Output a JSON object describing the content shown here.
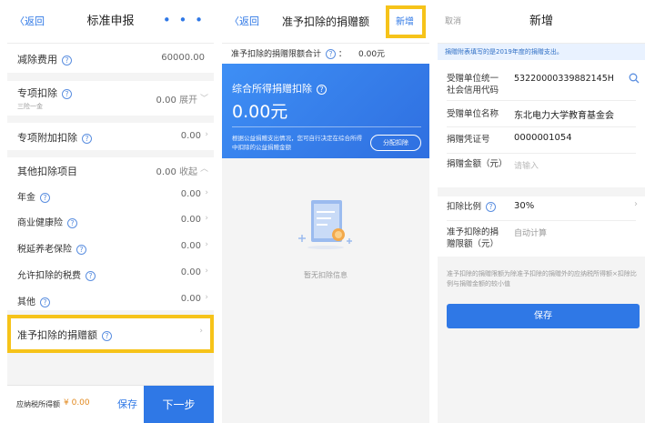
{
  "screen1": {
    "back": "〈返回",
    "title": "标准申报",
    "more": "• • •",
    "rows": {
      "deduct_cost_label": "减除费用",
      "deduct_cost_value": "60000.00",
      "special_label": "专项扣除",
      "special_sub": "三险一金",
      "special_value": "0.00",
      "special_action": "展开",
      "additional_label": "专项附加扣除",
      "additional_value": "0.00",
      "other_label": "其他扣除项目",
      "other_value": "0.00",
      "other_action": "收起",
      "annuity_label": "年金",
      "annuity_value": "0.00",
      "health_label": "商业健康险",
      "health_value": "0.00",
      "pension_label": "税延养老保险",
      "pension_value": "0.00",
      "allowed_tax_label": "允许扣除的税费",
      "allowed_tax_value": "0.00",
      "misc_label": "其他",
      "misc_value": "0.00",
      "donation_label": "准予扣除的捐赠额"
    },
    "bottom": {
      "tax_label": "应纳税所得额",
      "tax_value": "¥ 0.00",
      "save": "保存",
      "next": "下一步"
    }
  },
  "screen2": {
    "back": "〈返回",
    "title": "准予扣除的捐赠额",
    "add": "新增",
    "limit_label": "准予扣除的捐赠限额合计",
    "limit_value": "0.00元",
    "card_title": "综合所得捐赠扣除",
    "card_amount": "0.00元",
    "card_desc": "根据公益捐赠支出情况，您可自行决定在综合所得中扣除的公益捐赠金额",
    "card_button": "分配扣除",
    "empty_text": "暂无扣除信息"
  },
  "screen3": {
    "cancel": "取消",
    "title": "新增",
    "notice": "捐赠附表填写的是2019年度的捐赠支出。",
    "credit_code_label": "受赠单位统一社会信用代码",
    "credit_code_value": "53220000339882145H",
    "org_name_label": "受赠单位名称",
    "org_name_value": "东北电力大学教育基金会",
    "voucher_label": "捐赠凭证号",
    "voucher_value": "0000001054",
    "amount_label": "捐赠金额（元）",
    "amount_placeholder": "请输入",
    "ratio_label": "扣除比例",
    "ratio_value": "30%",
    "limit_label": "准予扣除的捐赠限额（元）",
    "limit_value": "自动计算",
    "note": "准予扣除的捐赠限额为除准予扣除的捐赠外的应纳税所得额×扣除比例与捐赠金额的较小值",
    "save": "保存"
  },
  "colors": {
    "accent": "#2f78e6",
    "highlight": "#f6c319",
    "amount": "#e2891f"
  }
}
